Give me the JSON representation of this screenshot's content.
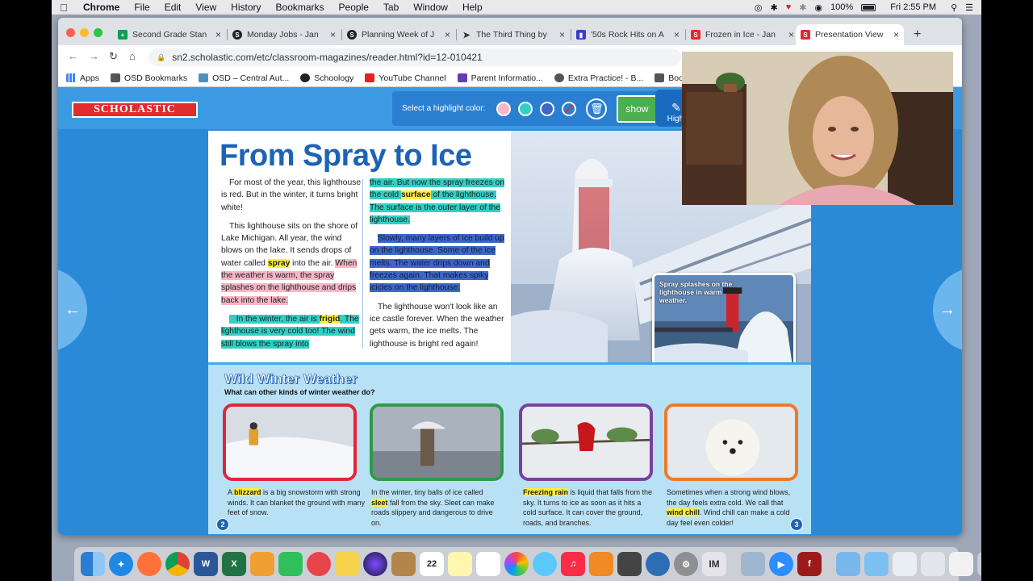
{
  "menubar": {
    "apple": "",
    "app": "Chrome",
    "items": [
      "File",
      "Edit",
      "View",
      "History",
      "Bookmarks",
      "People",
      "Tab",
      "Window",
      "Help"
    ],
    "battery": "100%",
    "clock": "Fri 2:55 PM"
  },
  "tabs": [
    {
      "title": "Second Grade Stan",
      "icon": "sheets-icon",
      "color": "#0f9d58"
    },
    {
      "title": "Monday Jobs - Jan",
      "icon": "schoology-icon",
      "color": "#222222"
    },
    {
      "title": "Planning Week of J",
      "icon": "schoology-icon",
      "color": "#222222"
    },
    {
      "title": "The Third Thing by",
      "icon": "bird-icon",
      "color": "#333333"
    },
    {
      "title": "'50s Rock Hits on A",
      "icon": "chart-icon",
      "color": "#3b3bd1"
    },
    {
      "title": "Frozen in Ice - Jan",
      "icon": "scholastic-icon",
      "color": "#e12b2d"
    },
    {
      "title": "Presentation View",
      "icon": "scholastic-icon",
      "color": "#e12b2d"
    }
  ],
  "url": "sn2.scholastic.com/etc/classroom-magazines/reader.html?id=12-010421",
  "bookmarks": [
    {
      "label": "Apps",
      "color": "#4285f4"
    },
    {
      "label": "OSD Bookmarks",
      "color": "#555555"
    },
    {
      "label": "OSD – Central Aut...",
      "color": "#4a90c0"
    },
    {
      "label": "Schoology",
      "color": "#222222"
    },
    {
      "label": "YouTube Channel",
      "color": "#e62117"
    },
    {
      "label": "Parent Informatio...",
      "color": "#673ab7"
    },
    {
      "label": "Extra Practice! - B...",
      "color": "#555555"
    },
    {
      "label": "Book",
      "color": "#555555"
    }
  ],
  "toolbar": {
    "logo": "SCHOLASTIC",
    "highlight_prompt": "Select a highlight color:",
    "highlight_colors": [
      "#f6b6c8",
      "#2fd0c5",
      "#3d67c9"
    ],
    "show_label": "show",
    "highlighter_label": "Highl"
  },
  "article": {
    "headline": "From Spray to Ice",
    "p1": "For most of the year, this lighthouse is red. But in the winter, it turns bright white!",
    "p2a": "This lighthouse sits on the shore of Lake Michigan. All year, the wind blows on the lake. It sends drops of water called ",
    "p2_kw": "spray",
    "p2b": " into the air. ",
    "p2_pink": "When the weather is warm, the spray splashes on the lighthouse and drips back into the lake.",
    "p3a": "In the winter, the air is ",
    "p3_kw": "frigid",
    "p3b": ". The lighthouse is very cold too! The wind still blows the spray into",
    "p3c": "the air. But now the spray freezes on the cold ",
    "p3_kw2": "surface",
    "p3d": " of the lighthouse. The surface is the outer layer of the lighthouse.",
    "p4": "Slowly, many layers of ice build up on the lighthouse. Some of the ice melts. The water drips down and freezes again. That makes spiky icicles on the lighthouse.",
    "p5": "The lighthouse won't look like an ice castle forever. When the weather gets warm, the ice melts. The lighthouse is bright red again!",
    "inset_caption": "Spray splashes on the lighthouse in warm weather."
  },
  "winter": {
    "title": "Wild Winter Weather",
    "subtitle": "What can other kinds of winter weather do?",
    "cards": [
      {
        "pre": "A ",
        "kw": "blizzard",
        "post": " is a big snowstorm with strong winds. It can blanket the ground with many feet of snow.",
        "border": "#e1253a"
      },
      {
        "pre": "In the winter, tiny balls of ice called ",
        "kw": "sleet",
        "post": " fall from the sky. Sleet can make roads slippery and dangerous to drive on.",
        "border": "#2e9a49"
      },
      {
        "pre": "",
        "kw": "Freezing rain",
        "post": " is liquid that falls from the sky. It turns to ice as soon as it hits a cold surface. It can cover the ground, roads, and branches.",
        "border": "#7a3fa0"
      },
      {
        "pre": "Sometimes when a strong wind blows, the day feels extra cold. We call that ",
        "kw": "wind chill",
        "post": ". Wind chill can make a cold day feel even colder!",
        "border": "#f07a26"
      }
    ],
    "page_left": "2",
    "page_right": "3"
  },
  "dock": {
    "calendar_day": "22",
    "im_label": "IM"
  }
}
